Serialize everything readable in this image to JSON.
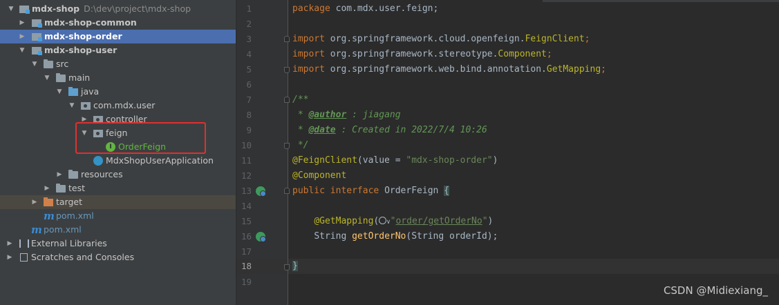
{
  "project_tree": {
    "root": {
      "name": "mdx-shop",
      "path": "D:\\dev\\project\\mdx-shop"
    },
    "items": [
      {
        "label": "mdx-shop-common"
      },
      {
        "label": "mdx-shop-order"
      },
      {
        "label": "mdx-shop-user"
      },
      {
        "label": "src"
      },
      {
        "label": "main"
      },
      {
        "label": "java"
      },
      {
        "label": "com.mdx.user"
      },
      {
        "label": "controller"
      },
      {
        "label": "feign"
      },
      {
        "label": "OrderFeign",
        "icon_letter": "I"
      },
      {
        "label": "MdxShopUserApplication"
      },
      {
        "label": "resources"
      },
      {
        "label": "test"
      },
      {
        "label": "target"
      },
      {
        "label": "pom.xml"
      },
      {
        "label": "pom.xml"
      },
      {
        "label": "External Libraries"
      },
      {
        "label": "Scratches and Consoles"
      }
    ]
  },
  "editor": {
    "line_numbers": [
      "1",
      "2",
      "3",
      "4",
      "5",
      "6",
      "7",
      "8",
      "9",
      "10",
      "11",
      "12",
      "13",
      "14",
      "15",
      "16",
      "17",
      "18",
      "19"
    ],
    "current_line": "18",
    "code": {
      "l1_kw": "package",
      "l1_rest": " com.mdx.user.feign;",
      "l3_kw": "import",
      "l3_rest": " org.springframework.cloud.openfeign.",
      "l3_cls": "FeignClient",
      "l3_end": ";",
      "l4_kw": "import",
      "l4_rest": " org.springframework.stereotype.",
      "l4_cls": "Component",
      "l4_end": ";",
      "l5_kw": "import",
      "l5_rest": " org.springframework.web.bind.annotation.",
      "l5_cls": "GetMapping",
      "l5_end": ";",
      "l7": "/**",
      "l8_pre": " * ",
      "l8_tag": "@author",
      "l8_rest": " : jiagang",
      "l9_pre": " * ",
      "l9_tag": "@date",
      "l9_rest": " : Created in 2022/7/4 10:26",
      "l10": " */",
      "l11_ann": "@FeignClient",
      "l11_a": "(value = ",
      "l11_str": "\"mdx-shop-order\"",
      "l11_b": ")",
      "l12_ann": "@Component",
      "l13_kw1": "public",
      "l13_kw2": "interface",
      "l13_name": "OrderFeign ",
      "l13_brace": "{",
      "l15_ann": "@GetMapping",
      "l15_a": "(",
      "l15_chev": "∨",
      "l15_q1": "\"",
      "l15_url": "order/getOrderNo",
      "l15_q2": "\"",
      "l15_b": ")",
      "l16_type": "String ",
      "l16_meth": "getOrderNo",
      "l16_rest": "(String orderId);",
      "l18_brace": "}"
    }
  },
  "watermark": "CSDN @Midiexiang_"
}
